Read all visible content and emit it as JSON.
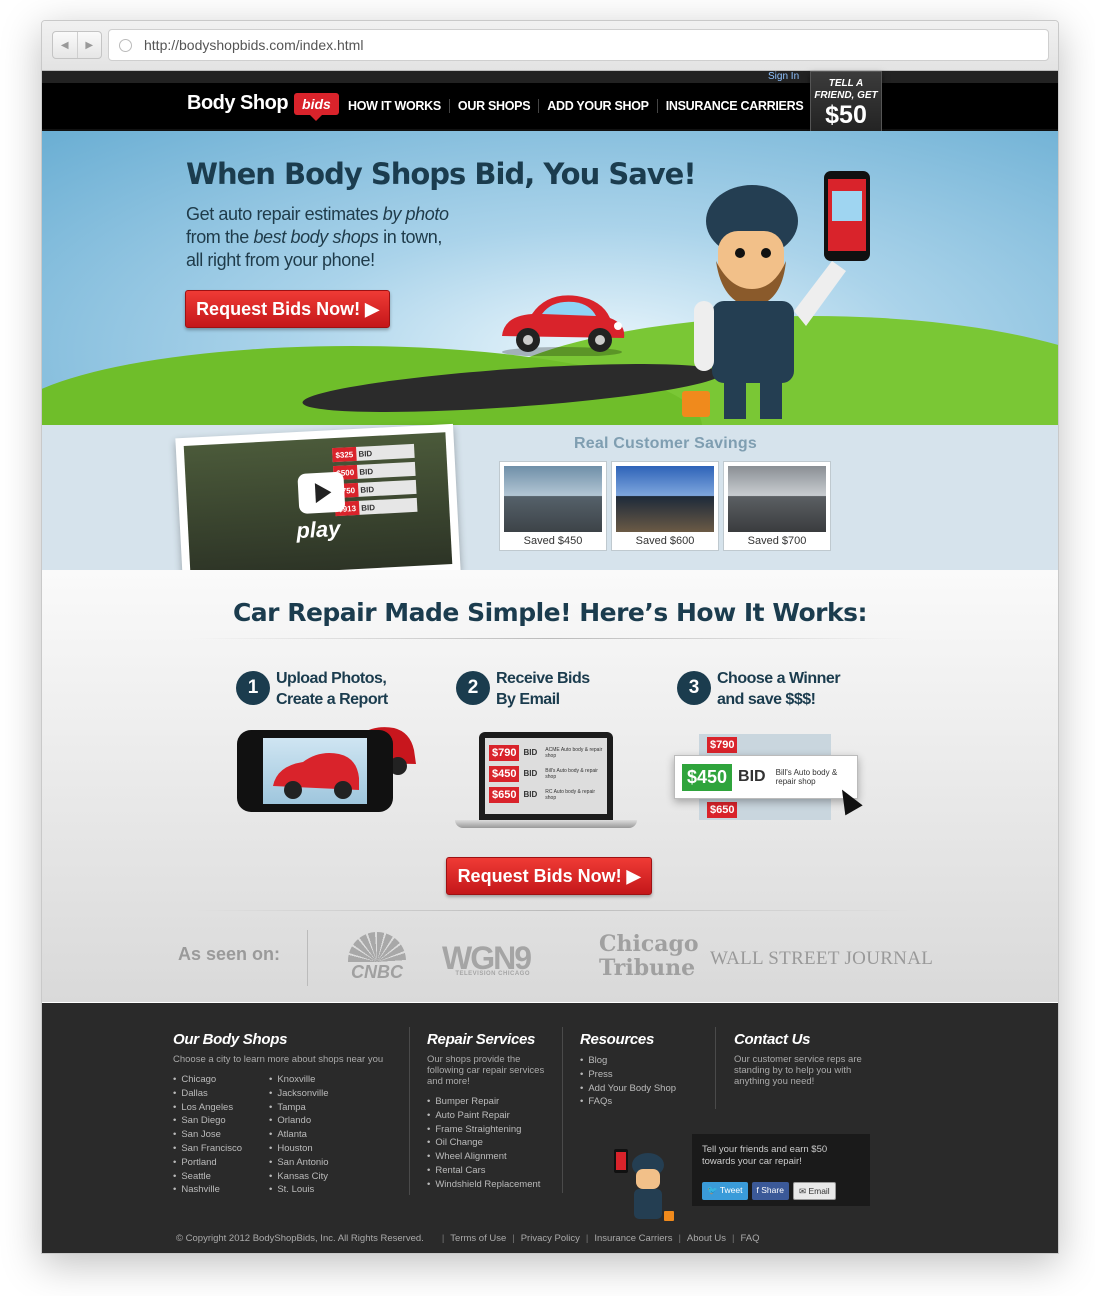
{
  "browser": {
    "url": "http://bodyshopbids.com/index.html"
  },
  "header": {
    "signin": "Sign In",
    "logo": {
      "text": "Body Shop",
      "badge": "bids"
    },
    "nav": [
      "HOW IT WORKS",
      "OUR SHOPS",
      "ADD YOUR SHOP",
      "INSURANCE CARRIERS"
    ],
    "tell_badge": {
      "line1": "TELL A",
      "line2": "FRIEND, GET",
      "amount": "$50"
    }
  },
  "hero": {
    "title": "When Body Shops Bid, You Save!",
    "sub1": "Get auto repair estimates ",
    "sub1_em": "by photo",
    "sub2": "from the ",
    "sub2_em": "best body shops",
    "sub3": " in town,",
    "sub4": "all right from your phone!",
    "cta": "Request Bids Now! ▶"
  },
  "video": {
    "play_label": "play",
    "bids": [
      {
        "price": "$325",
        "label": "BID"
      },
      {
        "price": "$500",
        "label": "BID"
      },
      {
        "price": "$750",
        "label": "BID"
      },
      {
        "price": "$913",
        "label": "BID"
      }
    ]
  },
  "savings": {
    "title": "Real Customer Savings",
    "items": [
      {
        "caption": "Saved $450"
      },
      {
        "caption": "Saved $600"
      },
      {
        "caption": "Saved $700"
      }
    ]
  },
  "how": {
    "title": "Car Repair Made Simple! Here’s How It Works:",
    "steps": [
      {
        "num": "1",
        "line1": "Upload Photos,",
        "line2": "Create a Report"
      },
      {
        "num": "2",
        "line1": "Receive Bids",
        "line2": "By Email"
      },
      {
        "num": "3",
        "line1": "Choose a Winner",
        "line2": "and save $$$!"
      }
    ],
    "laptop_bids": [
      {
        "price": "$790",
        "label": "BID",
        "shop": "ACME Auto body & repair shop"
      },
      {
        "price": "$450",
        "label": "BID",
        "shop": "Bill's Auto body & repair shop"
      },
      {
        "price": "$650",
        "label": "BID",
        "shop": "RC Auto body & repair shop"
      }
    ],
    "winner": {
      "price": "$450",
      "label": "BID",
      "shop": "Bill's Auto body & repair shop"
    },
    "stack_prices": [
      "$790",
      "$650"
    ],
    "cta": "Request Bids Now! ▶"
  },
  "seen_on": {
    "label": "As seen on:",
    "cnbc": "CNBC",
    "wgn": "WGN9",
    "wgn_sub": "TELEVISION CHICAGO",
    "tribune_1": "Chicago",
    "tribune_2": "Tribune",
    "wsj": "WALL STREET JOURNAL"
  },
  "footer": {
    "shops": {
      "title": "Our Body Shops",
      "desc": "Choose a city to learn more about shops near you",
      "col1": [
        "Chicago",
        "Dallas",
        "Los Angeles",
        "San Diego",
        "San Jose",
        "San Francisco",
        "Portland",
        "Seattle",
        "Nashville"
      ],
      "col2": [
        "Knoxville",
        "Jacksonville",
        "Tampa",
        "Orlando",
        "Atlanta",
        "Houston",
        "San Antonio",
        "Kansas City",
        "St. Louis"
      ]
    },
    "repair": {
      "title": "Repair Services",
      "desc": "Our shops provide the following car repair services and more!",
      "items": [
        "Bumper Repair",
        "Auto Paint Repair",
        "Frame Straightening",
        "Oil Change",
        "Wheel Alignment",
        "Rental Cars",
        "Windshield Replacement"
      ]
    },
    "resources": {
      "title": "Resources",
      "items": [
        "Blog",
        "Press",
        "Add Your Body Shop",
        "FAQs"
      ]
    },
    "contact": {
      "title": "Contact Us",
      "desc": "Our customer service reps are standing by to help you with anything you need!"
    },
    "tell": {
      "text": "Tell your friends and earn $50 towards your car repair!",
      "tweet": "Tweet",
      "share": "Share",
      "email": "Email"
    },
    "copyright": "© Copyright 2012 BodyShopBids, Inc. All Rights Reserved.",
    "links": [
      "Terms of Use",
      "Privacy Policy",
      "Insurance Carriers",
      "About Us",
      "FAQ"
    ]
  }
}
